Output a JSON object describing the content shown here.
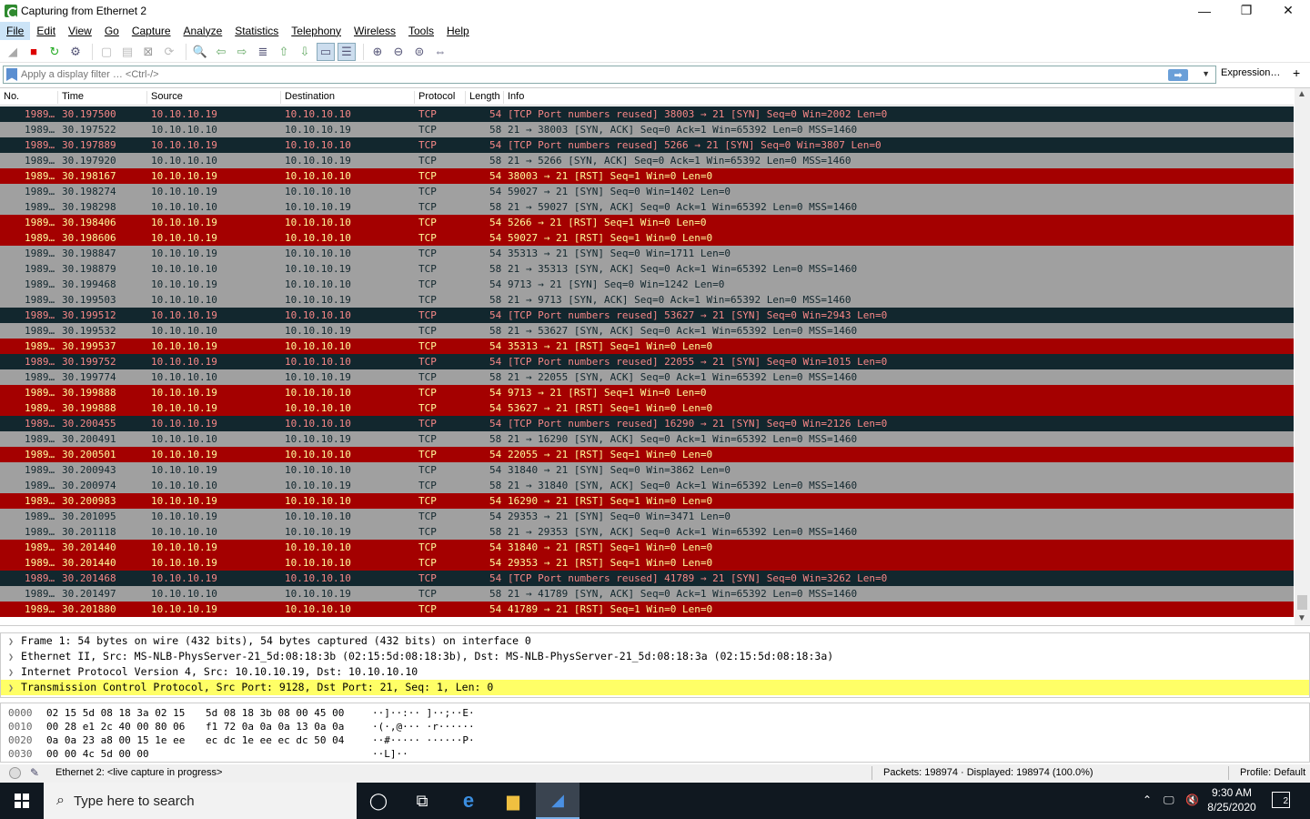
{
  "window": {
    "title": "Capturing from Ethernet 2"
  },
  "menu": [
    "File",
    "Edit",
    "View",
    "Go",
    "Capture",
    "Analyze",
    "Statistics",
    "Telephony",
    "Wireless",
    "Tools",
    "Help"
  ],
  "filter": {
    "placeholder": "Apply a display filter … <Ctrl-/>",
    "expression_label": "Expression…",
    "add_label": "+"
  },
  "columns": [
    "No.",
    "Time",
    "Source",
    "Destination",
    "Protocol",
    "Length",
    "Info"
  ],
  "packets": [
    {
      "no": "1989…",
      "time": "30.197500",
      "src": "10.10.10.19",
      "dst": "10.10.10.10",
      "proto": "TCP",
      "len": "54",
      "info": "[TCP Port numbers reused] 38003 → 21 [SYN] Seq=0 Win=2002 Len=0",
      "kind": "syn-reuse"
    },
    {
      "no": "1989…",
      "time": "30.197522",
      "src": "10.10.10.10",
      "dst": "10.10.10.19",
      "proto": "TCP",
      "len": "58",
      "info": "21 → 38003 [SYN, ACK] Seq=0 Ack=1 Win=65392 Len=0 MSS=1460",
      "kind": "normal"
    },
    {
      "no": "1989…",
      "time": "30.197889",
      "src": "10.10.10.19",
      "dst": "10.10.10.10",
      "proto": "TCP",
      "len": "54",
      "info": "[TCP Port numbers reused] 5266 → 21 [SYN] Seq=0 Win=3807 Len=0",
      "kind": "syn-reuse"
    },
    {
      "no": "1989…",
      "time": "30.197920",
      "src": "10.10.10.10",
      "dst": "10.10.10.19",
      "proto": "TCP",
      "len": "58",
      "info": "21 → 5266 [SYN, ACK] Seq=0 Ack=1 Win=65392 Len=0 MSS=1460",
      "kind": "normal"
    },
    {
      "no": "1989…",
      "time": "30.198167",
      "src": "10.10.10.19",
      "dst": "10.10.10.10",
      "proto": "TCP",
      "len": "54",
      "info": "38003 → 21 [RST] Seq=1 Win=0 Len=0",
      "kind": "rst"
    },
    {
      "no": "1989…",
      "time": "30.198274",
      "src": "10.10.10.19",
      "dst": "10.10.10.10",
      "proto": "TCP",
      "len": "54",
      "info": "59027 → 21 [SYN] Seq=0 Win=1402 Len=0",
      "kind": "normal"
    },
    {
      "no": "1989…",
      "time": "30.198298",
      "src": "10.10.10.10",
      "dst": "10.10.10.19",
      "proto": "TCP",
      "len": "58",
      "info": "21 → 59027 [SYN, ACK] Seq=0 Ack=1 Win=65392 Len=0 MSS=1460",
      "kind": "normal"
    },
    {
      "no": "1989…",
      "time": "30.198406",
      "src": "10.10.10.19",
      "dst": "10.10.10.10",
      "proto": "TCP",
      "len": "54",
      "info": "5266 → 21 [RST] Seq=1 Win=0 Len=0",
      "kind": "rst"
    },
    {
      "no": "1989…",
      "time": "30.198606",
      "src": "10.10.10.19",
      "dst": "10.10.10.10",
      "proto": "TCP",
      "len": "54",
      "info": "59027 → 21 [RST] Seq=1 Win=0 Len=0",
      "kind": "rst"
    },
    {
      "no": "1989…",
      "time": "30.198847",
      "src": "10.10.10.19",
      "dst": "10.10.10.10",
      "proto": "TCP",
      "len": "54",
      "info": "35313 → 21 [SYN] Seq=0 Win=1711 Len=0",
      "kind": "normal"
    },
    {
      "no": "1989…",
      "time": "30.198879",
      "src": "10.10.10.10",
      "dst": "10.10.10.19",
      "proto": "TCP",
      "len": "58",
      "info": "21 → 35313 [SYN, ACK] Seq=0 Ack=1 Win=65392 Len=0 MSS=1460",
      "kind": "normal"
    },
    {
      "no": "1989…",
      "time": "30.199468",
      "src": "10.10.10.19",
      "dst": "10.10.10.10",
      "proto": "TCP",
      "len": "54",
      "info": "9713 → 21 [SYN] Seq=0 Win=1242 Len=0",
      "kind": "normal"
    },
    {
      "no": "1989…",
      "time": "30.199503",
      "src": "10.10.10.10",
      "dst": "10.10.10.19",
      "proto": "TCP",
      "len": "58",
      "info": "21 → 9713 [SYN, ACK] Seq=0 Ack=1 Win=65392 Len=0 MSS=1460",
      "kind": "normal"
    },
    {
      "no": "1989…",
      "time": "30.199512",
      "src": "10.10.10.19",
      "dst": "10.10.10.10",
      "proto": "TCP",
      "len": "54",
      "info": "[TCP Port numbers reused] 53627 → 21 [SYN] Seq=0 Win=2943 Len=0",
      "kind": "syn-reuse"
    },
    {
      "no": "1989…",
      "time": "30.199532",
      "src": "10.10.10.10",
      "dst": "10.10.10.19",
      "proto": "TCP",
      "len": "58",
      "info": "21 → 53627 [SYN, ACK] Seq=0 Ack=1 Win=65392 Len=0 MSS=1460",
      "kind": "normal"
    },
    {
      "no": "1989…",
      "time": "30.199537",
      "src": "10.10.10.19",
      "dst": "10.10.10.10",
      "proto": "TCP",
      "len": "54",
      "info": "35313 → 21 [RST] Seq=1 Win=0 Len=0",
      "kind": "rst"
    },
    {
      "no": "1989…",
      "time": "30.199752",
      "src": "10.10.10.19",
      "dst": "10.10.10.10",
      "proto": "TCP",
      "len": "54",
      "info": "[TCP Port numbers reused] 22055 → 21 [SYN] Seq=0 Win=1015 Len=0",
      "kind": "syn-reuse"
    },
    {
      "no": "1989…",
      "time": "30.199774",
      "src": "10.10.10.10",
      "dst": "10.10.10.19",
      "proto": "TCP",
      "len": "58",
      "info": "21 → 22055 [SYN, ACK] Seq=0 Ack=1 Win=65392 Len=0 MSS=1460",
      "kind": "normal"
    },
    {
      "no": "1989…",
      "time": "30.199888",
      "src": "10.10.10.19",
      "dst": "10.10.10.10",
      "proto": "TCP",
      "len": "54",
      "info": "9713 → 21 [RST] Seq=1 Win=0 Len=0",
      "kind": "rst"
    },
    {
      "no": "1989…",
      "time": "30.199888",
      "src": "10.10.10.19",
      "dst": "10.10.10.10",
      "proto": "TCP",
      "len": "54",
      "info": "53627 → 21 [RST] Seq=1 Win=0 Len=0",
      "kind": "rst"
    },
    {
      "no": "1989…",
      "time": "30.200455",
      "src": "10.10.10.19",
      "dst": "10.10.10.10",
      "proto": "TCP",
      "len": "54",
      "info": "[TCP Port numbers reused] 16290 → 21 [SYN] Seq=0 Win=2126 Len=0",
      "kind": "syn-reuse"
    },
    {
      "no": "1989…",
      "time": "30.200491",
      "src": "10.10.10.10",
      "dst": "10.10.10.19",
      "proto": "TCP",
      "len": "58",
      "info": "21 → 16290 [SYN, ACK] Seq=0 Ack=1 Win=65392 Len=0 MSS=1460",
      "kind": "normal"
    },
    {
      "no": "1989…",
      "time": "30.200501",
      "src": "10.10.10.19",
      "dst": "10.10.10.10",
      "proto": "TCP",
      "len": "54",
      "info": "22055 → 21 [RST] Seq=1 Win=0 Len=0",
      "kind": "rst"
    },
    {
      "no": "1989…",
      "time": "30.200943",
      "src": "10.10.10.19",
      "dst": "10.10.10.10",
      "proto": "TCP",
      "len": "54",
      "info": "31840 → 21 [SYN] Seq=0 Win=3862 Len=0",
      "kind": "normal"
    },
    {
      "no": "1989…",
      "time": "30.200974",
      "src": "10.10.10.10",
      "dst": "10.10.10.19",
      "proto": "TCP",
      "len": "58",
      "info": "21 → 31840 [SYN, ACK] Seq=0 Ack=1 Win=65392 Len=0 MSS=1460",
      "kind": "normal"
    },
    {
      "no": "1989…",
      "time": "30.200983",
      "src": "10.10.10.19",
      "dst": "10.10.10.10",
      "proto": "TCP",
      "len": "54",
      "info": "16290 → 21 [RST] Seq=1 Win=0 Len=0",
      "kind": "rst"
    },
    {
      "no": "1989…",
      "time": "30.201095",
      "src": "10.10.10.19",
      "dst": "10.10.10.10",
      "proto": "TCP",
      "len": "54",
      "info": "29353 → 21 [SYN] Seq=0 Win=3471 Len=0",
      "kind": "normal"
    },
    {
      "no": "1989…",
      "time": "30.201118",
      "src": "10.10.10.10",
      "dst": "10.10.10.19",
      "proto": "TCP",
      "len": "58",
      "info": "21 → 29353 [SYN, ACK] Seq=0 Ack=1 Win=65392 Len=0 MSS=1460",
      "kind": "normal"
    },
    {
      "no": "1989…",
      "time": "30.201440",
      "src": "10.10.10.19",
      "dst": "10.10.10.10",
      "proto": "TCP",
      "len": "54",
      "info": "31840 → 21 [RST] Seq=1 Win=0 Len=0",
      "kind": "rst"
    },
    {
      "no": "1989…",
      "time": "30.201440",
      "src": "10.10.10.19",
      "dst": "10.10.10.10",
      "proto": "TCP",
      "len": "54",
      "info": "29353 → 21 [RST] Seq=1 Win=0 Len=0",
      "kind": "rst"
    },
    {
      "no": "1989…",
      "time": "30.201468",
      "src": "10.10.10.19",
      "dst": "10.10.10.10",
      "proto": "TCP",
      "len": "54",
      "info": "[TCP Port numbers reused] 41789 → 21 [SYN] Seq=0 Win=3262 Len=0",
      "kind": "syn-reuse"
    },
    {
      "no": "1989…",
      "time": "30.201497",
      "src": "10.10.10.10",
      "dst": "10.10.10.19",
      "proto": "TCP",
      "len": "58",
      "info": "21 → 41789 [SYN, ACK] Seq=0 Ack=1 Win=65392 Len=0 MSS=1460",
      "kind": "normal"
    },
    {
      "no": "1989…",
      "time": "30.201880",
      "src": "10.10.10.19",
      "dst": "10.10.10.10",
      "proto": "TCP",
      "len": "54",
      "info": "41789 → 21 [RST] Seq=1 Win=0 Len=0",
      "kind": "rst"
    }
  ],
  "details": [
    {
      "text": "Frame 1: 54 bytes on wire (432 bits), 54 bytes captured (432 bits) on interface 0",
      "highlight": false
    },
    {
      "text": "Ethernet II, Src: MS-NLB-PhysServer-21_5d:08:18:3b (02:15:5d:08:18:3b), Dst: MS-NLB-PhysServer-21_5d:08:18:3a (02:15:5d:08:18:3a)",
      "highlight": false
    },
    {
      "text": "Internet Protocol Version 4, Src: 10.10.10.19, Dst: 10.10.10.10",
      "highlight": false
    },
    {
      "text": "Transmission Control Protocol, Src Port: 9128, Dst Port: 21, Seq: 1, Len: 0",
      "highlight": true
    }
  ],
  "bytes": [
    {
      "off": "0000",
      "hex1": "02 15 5d 08 18 3a 02 15",
      "hex2": "5d 08 18 3b 08 00 45 00",
      "ascii": "··]··:·· ]··;··E·"
    },
    {
      "off": "0010",
      "hex1": "00 28 e1 2c 40 00 80 06",
      "hex2": "f1 72 0a 0a 0a 13 0a 0a",
      "ascii": "·(·,@··· ·r······"
    },
    {
      "off": "0020",
      "hex1": "0a 0a 23 a8 00 15 1e ee",
      "hex2": "ec dc 1e ee ec dc 50 04",
      "ascii": "··#····· ······P·"
    },
    {
      "off": "0030",
      "hex1": "00 00 4c 5d 00 00",
      "hex2": "",
      "ascii": "··L]··"
    }
  ],
  "status": {
    "interface": "Ethernet 2: <live capture in progress>",
    "packets": "Packets: 198974 · Displayed: 198974 (100.0%)",
    "profile": "Profile: Default"
  },
  "taskbar": {
    "search_placeholder": "Type here to search",
    "time": "9:30 AM",
    "date": "8/25/2020",
    "notif_count": "2"
  },
  "colors": {
    "syn_reuse_bg": "#12272e",
    "rst_bg": "#a40000",
    "normal_bg": "#a0a0a0",
    "highlight": "#ffff66"
  }
}
